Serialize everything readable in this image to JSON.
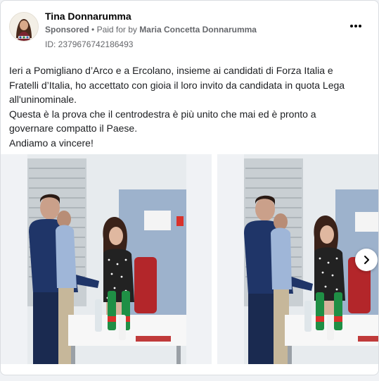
{
  "post": {
    "author_name": "Tina Donnarumma",
    "sponsored_label": "Sponsored",
    "separator": "•",
    "paid_for_prefix": "Paid for by",
    "paid_for_name": "Maria Concetta Donnarumma",
    "ad_id": "ID: 2379676742186493",
    "more_icon": "more-horizontal-icon",
    "text_lines": [
      "Ieri a Pomigliano d’Arco e a Ercolano, insieme ai candidati di Forza Italia e Fratelli d’Italia, ho accettato con gioia il loro invito da candidata in quota Lega all'uninominale.",
      "Questa è la prova che il centrodestra è più unito che mai ed è pronto a governare compatto il Paese.",
      "Andiamo a vincere!"
    ]
  },
  "carousel": {
    "slide_count_visible": 2,
    "next_icon": "chevron-right-icon"
  },
  "colors": {
    "text_primary": "#050505",
    "text_secondary": "#65676b",
    "card_border": "#dadde1",
    "page_bg": "#f0f2f5"
  }
}
